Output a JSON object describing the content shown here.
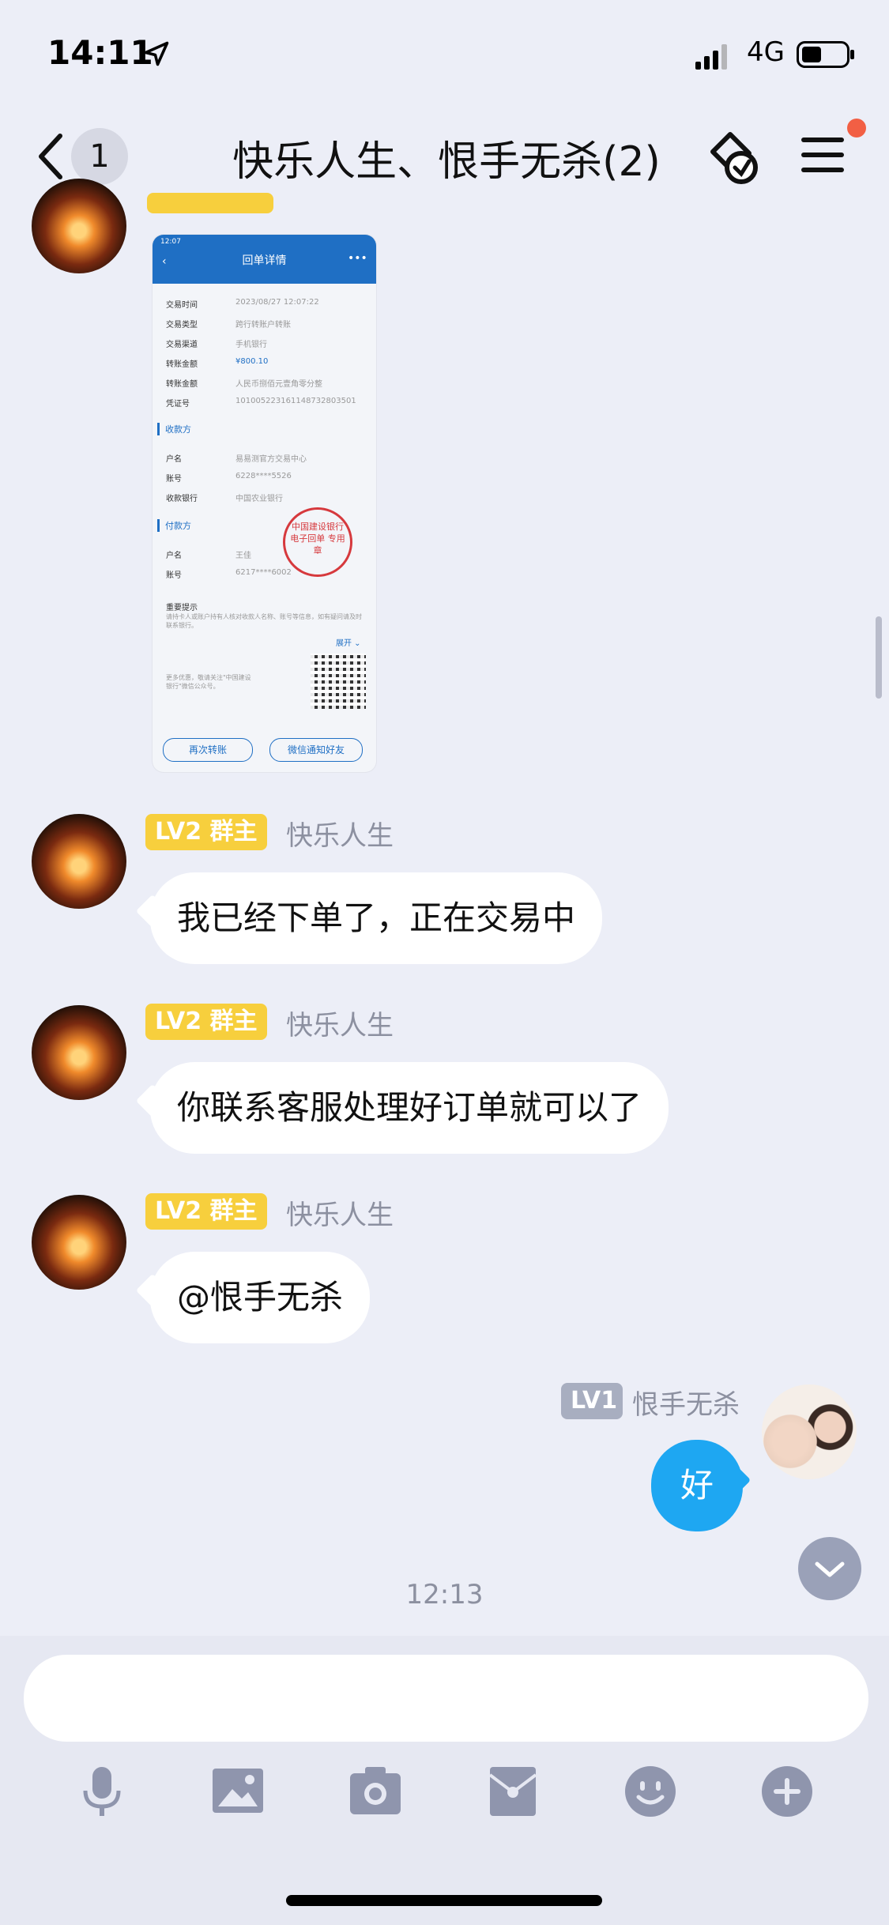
{
  "status_bar": {
    "time": "14:11",
    "network": "4G"
  },
  "header": {
    "back_badge": "1",
    "title": "快乐人生、恨手无杀(2)"
  },
  "receipt_image": {
    "status_time": "12:07",
    "title": "回单详情",
    "rows": [
      {
        "label": "交易时间",
        "value": "2023/08/27 12:07:22"
      },
      {
        "label": "交易类型",
        "value": "跨行转账户转账"
      },
      {
        "label": "交易渠道",
        "value": "手机银行"
      },
      {
        "label": "转账金额",
        "value": "¥800.10"
      },
      {
        "label": "转账金额",
        "value": "人民币捌佰元壹角零分整"
      },
      {
        "label": "凭证号",
        "value": "101005223161148732803501"
      }
    ],
    "payee_section": "收款方",
    "payee_rows": [
      {
        "label": "户名",
        "value": "易易测官方交易中心"
      },
      {
        "label": "账号",
        "value": "6228****5526"
      },
      {
        "label": "收款银行",
        "value": "中国农业银行"
      }
    ],
    "payer_section": "付款方",
    "payer_rows": [
      {
        "label": "户名",
        "value": "王佳"
      },
      {
        "label": "账号",
        "value": "6217****6002"
      }
    ],
    "notice_title": "重要提示",
    "notice_text": "请持卡人或账户持有人核对收款人名称、账号等信息，如有疑问请及时联系银行。",
    "expand": "展开",
    "more_text": "更多优惠，敬请关注\"中国建设银行\"微信公众号。",
    "stamp_text": "中国建设银行 电子回单 专用章",
    "btn_again": "再次转账",
    "btn_notify": "微信通知好友"
  },
  "messages": [
    {
      "badge": "LV2 群主",
      "sender": "快乐人生",
      "text": "我已经下单了，正在交易中"
    },
    {
      "badge": "LV2 群主",
      "sender": "快乐人生",
      "text": "你联系客服处理好订单就可以了"
    },
    {
      "badge": "LV2 群主",
      "sender": "快乐人生",
      "text": "@恨手无杀"
    }
  ],
  "my_message": {
    "badge": "LV1",
    "sender": "恨手无杀",
    "text": "好"
  },
  "timestamp": "12:13",
  "input": {
    "placeholder": ""
  },
  "colors": {
    "accent": "#1ea7f2",
    "owner_badge": "#f7cf3d",
    "background": "#eceef7"
  }
}
